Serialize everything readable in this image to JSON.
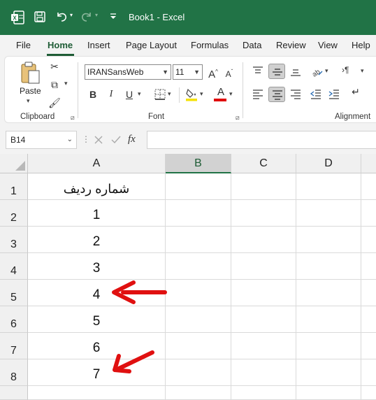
{
  "titlebar": {
    "title": "Book1  -  Excel",
    "bg_color": "#217346",
    "icons": [
      "excel-logo-icon",
      "save-icon",
      "undo-icon",
      "redo-icon",
      "customize-qat-icon"
    ]
  },
  "tabs": [
    "File",
    "Home",
    "Insert",
    "Page Layout",
    "Formulas",
    "Data",
    "Review",
    "View",
    "Help"
  ],
  "active_tab": "Home",
  "ribbon": {
    "clipboard": {
      "paste_label": "Paste",
      "group_label": "Clipboard"
    },
    "font": {
      "font_name": "IRANSansWeb",
      "font_size": "11",
      "group_label": "Font",
      "fill_color": "#f5e100",
      "text_color": "#e00000"
    },
    "alignment": {
      "group_label": "Alignment"
    }
  },
  "formula_bar": {
    "name_box": "B14",
    "fx_label": "fx",
    "value": ""
  },
  "columns": [
    "A",
    "B",
    "C",
    "D"
  ],
  "selected_column": "B",
  "rows": [
    {
      "num": "1",
      "a": "شماره ردیف"
    },
    {
      "num": "2",
      "a": "1"
    },
    {
      "num": "3",
      "a": "2"
    },
    {
      "num": "4",
      "a": "3"
    },
    {
      "num": "5",
      "a": "4"
    },
    {
      "num": "6",
      "a": "5"
    },
    {
      "num": "7",
      "a": "6"
    },
    {
      "num": "8",
      "a": "7"
    }
  ],
  "annotations": {
    "arrow_color": "#e01010",
    "arrows": [
      "arrow-row-5",
      "arrow-row-8"
    ]
  }
}
